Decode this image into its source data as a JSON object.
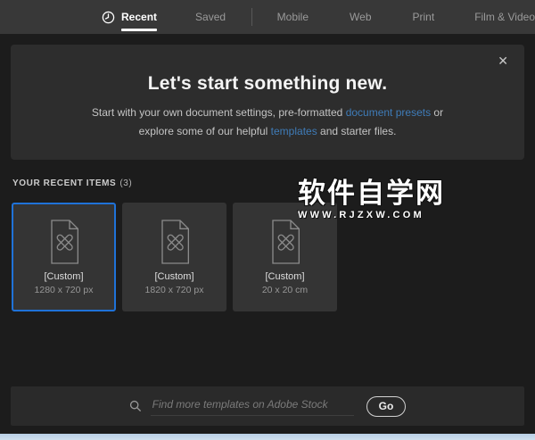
{
  "tabs": {
    "items": [
      {
        "label": "Recent",
        "active": true
      },
      {
        "label": "Saved",
        "active": false
      },
      {
        "label": "Mobile",
        "active": false
      },
      {
        "label": "Web",
        "active": false
      },
      {
        "label": "Print",
        "active": false
      },
      {
        "label": "Film & Video",
        "active": false
      }
    ]
  },
  "banner": {
    "title": "Let's start something new.",
    "subtitle": {
      "before_link1": "Start with your own document settings, pre-formatted ",
      "link1": "document presets",
      "between_links": " or explore some of our helpful ",
      "link2": "templates",
      "after_link2": " and starter files."
    },
    "close_glyph": "✕"
  },
  "recent_section": {
    "label": "YOUR RECENT ITEMS",
    "count": "(3)",
    "items": [
      {
        "name": "[Custom]",
        "dimensions": "1280 x 720 px",
        "selected": true
      },
      {
        "name": "[Custom]",
        "dimensions": "1820 x 720 px",
        "selected": false
      },
      {
        "name": "[Custom]",
        "dimensions": "20 x 20 cm",
        "selected": false
      }
    ]
  },
  "watermark": {
    "line1": "软件自学网",
    "line2": "WWW.RJZXW.COM"
  },
  "search": {
    "placeholder": "Find more templates on Adobe Stock",
    "go_label": "Go"
  },
  "colors": {
    "selection_blue": "#1f72d8",
    "link_blue": "#3f7cb8",
    "bottom_strip": "#cfe0ef"
  }
}
